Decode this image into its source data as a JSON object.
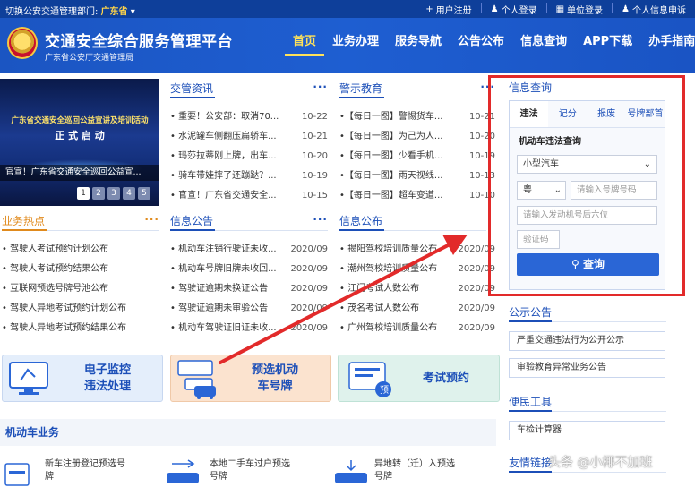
{
  "topbar": {
    "switch_label": "切换公安交通管理部门:",
    "region": "广东省",
    "links": [
      "用户注册",
      "个人登录",
      "单位登录",
      "个人信息申诉"
    ]
  },
  "header": {
    "title": "交通安全综合服务管理平台",
    "subtitle": "广东省公安厅交通管理局",
    "nav": [
      "首页",
      "业务办理",
      "服务导航",
      "公告公布",
      "信息查询",
      "APP下载",
      "办手指南"
    ]
  },
  "banner": {
    "headline_small": "广东省交通安全巡回公益宣讲及培训活动",
    "headline_big": "正 式 启 动",
    "caption": "官宣！广东省交通安全巡回公益宣...",
    "pages": [
      "1",
      "2",
      "3",
      "4",
      "5"
    ]
  },
  "panels": {
    "traffic_news": {
      "title": "交管资讯",
      "more": "···",
      "items": [
        {
          "t": "• 重要！公安部：取消70...",
          "d": "10-22"
        },
        {
          "t": "• 水泥罐车侧翻压扁轿车...",
          "d": "10-21"
        },
        {
          "t": "• 玛莎拉蒂刚上牌，出车...",
          "d": "10-20"
        },
        {
          "t": "• 骑车带娃摔了还蹦跶？...",
          "d": "10-19"
        },
        {
          "t": "• 官宣！广东省交通安全...",
          "d": "10-15"
        }
      ]
    },
    "warning": {
      "title": "警示教育",
      "more": "···",
      "items": [
        {
          "t": "•【每日一图】警惕货车...",
          "d": "10-21"
        },
        {
          "t": "•【每日一图】为己为人...",
          "d": "10-20"
        },
        {
          "t": "•【每日一图】少看手机...",
          "d": "10-19"
        },
        {
          "t": "•【每日一图】雨天视线...",
          "d": "10-13"
        },
        {
          "t": "•【每日一图】超车变道...",
          "d": "10-10"
        }
      ]
    },
    "hot": {
      "title": "业务热点",
      "more": "···",
      "items": [
        "• 驾驶人考试预约计划公布",
        "• 驾驶人考试预约结果公布",
        "• 互联网预选号牌号池公布",
        "• 驾驶人异地考试预约计划公布",
        "• 驾驶人异地考试预约结果公布"
      ]
    },
    "info_notice": {
      "title": "信息公告",
      "more": "···",
      "items": [
        {
          "t": "• 机动车注销行驶证未收...",
          "d": "2020/09"
        },
        {
          "t": "• 机动车号牌旧牌未收回...",
          "d": "2020/09"
        },
        {
          "t": "• 驾驶证逾期未换证公告",
          "d": "2020/09"
        },
        {
          "t": "• 驾驶证逾期未审验公告",
          "d": "2020/09"
        },
        {
          "t": "• 机动车驾驶证旧证未收...",
          "d": "2020/09"
        }
      ]
    },
    "info_publish": {
      "title": "信息公布",
      "items": [
        {
          "t": "• 揭阳驾校培训质量公布",
          "d": "2020/09"
        },
        {
          "t": "• 潮州驾校培训质量公布",
          "d": "2020/09"
        },
        {
          "t": "• 江门考试人数公布",
          "d": "2020/09"
        },
        {
          "t": "• 茂名考试人数公布",
          "d": "2020/09"
        },
        {
          "t": "• 广州驾校培训质量公布",
          "d": "2020/09"
        }
      ]
    }
  },
  "tiles": {
    "monitor": [
      "电子监控",
      "违法处理"
    ],
    "plate": [
      "预选机动",
      "车号牌"
    ],
    "exam": [
      "考试预约"
    ]
  },
  "vehicle": {
    "title": "机动车业务",
    "items": [
      [
        "新车注册登记预选号",
        "牌"
      ],
      [
        "本地二手车过户预选",
        "号牌"
      ],
      [
        "异地转（迁）入预选",
        "号牌"
      ]
    ]
  },
  "query": {
    "title": "信息查询",
    "tabs": [
      "违法",
      "记分",
      "报废",
      "号牌部首"
    ],
    "subtitle": "机动车违法查询",
    "vehicle_type": "小型汽车",
    "plate_prefix": "粤",
    "plate_placeholder": "请输入号牌号码",
    "engine_placeholder": "请输入发动机号后六位",
    "code_placeholder": "验证码",
    "button": "查询"
  },
  "right": {
    "notice_title": "公示公告",
    "notices": [
      "严重交通违法行为公开公示",
      "审验教育异常业务公告"
    ],
    "tools_title": "便民工具",
    "tools": [
      "车检计算器"
    ],
    "links_title": "友情链接"
  },
  "watermark": "头条 @小椰不加班",
  "colors": {
    "brand_blue": "#1c4fb8",
    "header_blue": "#1b55c2",
    "highlight": "#e22a2a",
    "hot_orange": "#e08a1d"
  }
}
